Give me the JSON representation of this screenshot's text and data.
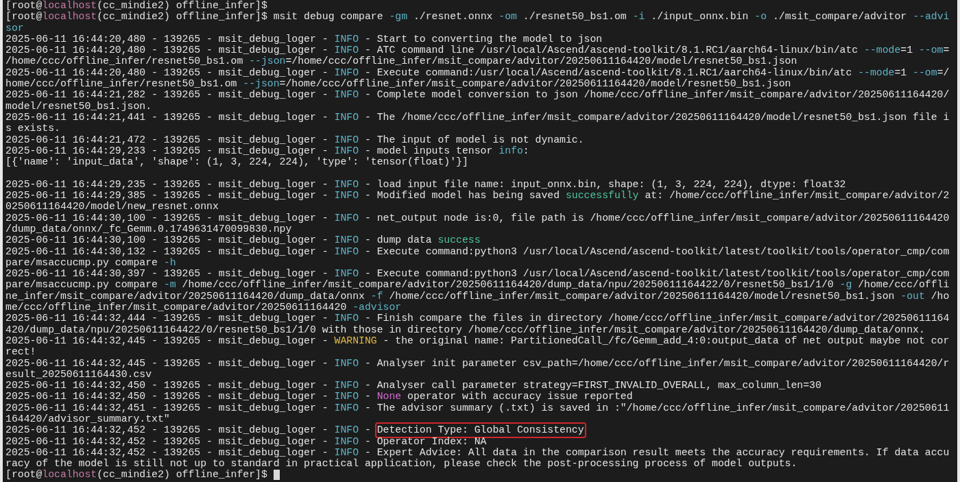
{
  "terminal": {
    "lines": [
      {
        "segments": [
          {
            "text": "[root@",
            "kind": "text"
          },
          {
            "text": "localhost",
            "kind": "host"
          },
          {
            "text": "(cc_mindie2) offline_infer]$",
            "kind": "text"
          }
        ]
      },
      {
        "segments": [
          {
            "text": "[root@",
            "kind": "text"
          },
          {
            "text": "localhost",
            "kind": "host"
          },
          {
            "text": "(cc_mindie2) offline_infer]$ msit debug compare ",
            "kind": "text"
          },
          {
            "text": "-gm",
            "kind": "flag"
          },
          {
            "text": " ./resnet.onnx ",
            "kind": "text"
          },
          {
            "text": "-om",
            "kind": "flag"
          },
          {
            "text": " ./resnet50_bs1.om ",
            "kind": "text"
          },
          {
            "text": "-i",
            "kind": "flag"
          },
          {
            "text": " ./input_onnx.bin ",
            "kind": "text"
          },
          {
            "text": "-o",
            "kind": "flag"
          },
          {
            "text": " ./msit_compare/advitor ",
            "kind": "text"
          },
          {
            "text": "--advi",
            "kind": "flag"
          }
        ]
      },
      {
        "segments": [
          {
            "text": "sor",
            "kind": "flag"
          }
        ]
      },
      {
        "segments": [
          {
            "text": "2025-06-11 16:44:20,480 - 139265 - msit_debug_loger - ",
            "kind": "text"
          },
          {
            "text": "INFO",
            "kind": "info"
          },
          {
            "text": " - Start to converting the model to json",
            "kind": "text"
          }
        ]
      },
      {
        "segments": [
          {
            "text": "2025-06-11 16:44:20,480 - 139265 - msit_debug_loger - ",
            "kind": "text"
          },
          {
            "text": "INFO",
            "kind": "info"
          },
          {
            "text": " - ATC command line /usr/local/Ascend/ascend-toolkit/8.1.RC1/aarch64-linux/bin/atc ",
            "kind": "text"
          },
          {
            "text": "--mode",
            "kind": "flag"
          },
          {
            "text": "=1 ",
            "kind": "text"
          },
          {
            "text": "--om",
            "kind": "flag"
          },
          {
            "text": "=",
            "kind": "text"
          }
        ]
      },
      {
        "segments": [
          {
            "text": "/home/ccc/offline_infer/resnet50_bs1.om ",
            "kind": "text"
          },
          {
            "text": "--json",
            "kind": "flag"
          },
          {
            "text": "=/home/ccc/offline_infer/msit_compare/advitor/20250611164420/model/resnet50_bs1.json",
            "kind": "text"
          }
        ]
      },
      {
        "segments": [
          {
            "text": "2025-06-11 16:44:20,480 - 139265 - msit_debug_loger - ",
            "kind": "text"
          },
          {
            "text": "INFO",
            "kind": "info"
          },
          {
            "text": " - Execute command:/usr/local/Ascend/ascend-toolkit/8.1.RC1/aarch64-linux/bin/atc ",
            "kind": "text"
          },
          {
            "text": "--mode",
            "kind": "flag"
          },
          {
            "text": "=1 ",
            "kind": "text"
          },
          {
            "text": "--om",
            "kind": "flag"
          },
          {
            "text": "=/",
            "kind": "text"
          }
        ]
      },
      {
        "segments": [
          {
            "text": "home/ccc/offline_infer/resnet50_bs1.om ",
            "kind": "text"
          },
          {
            "text": "--json",
            "kind": "flag"
          },
          {
            "text": "=/home/ccc/offline_infer/msit_compare/advitor/20250611164420/model/resnet50_bs1.json",
            "kind": "text"
          }
        ]
      },
      {
        "segments": [
          {
            "text": "2025-06-11 16:44:21,282 - 139265 - msit_debug_loger - ",
            "kind": "text"
          },
          {
            "text": "INFO",
            "kind": "info"
          },
          {
            "text": " - Complete model conversion to json /home/ccc/offline_infer/msit_compare/advitor/20250611164420/",
            "kind": "text"
          }
        ]
      },
      {
        "segments": [
          {
            "text": "model/resnet50_bs1.json.",
            "kind": "text"
          }
        ]
      },
      {
        "segments": [
          {
            "text": "2025-06-11 16:44:21,441 - 139265 - msit_debug_loger - ",
            "kind": "text"
          },
          {
            "text": "INFO",
            "kind": "info"
          },
          {
            "text": " - The /home/ccc/offline_infer/msit_compare/advitor/20250611164420/model/resnet50_bs1.json file i",
            "kind": "text"
          }
        ]
      },
      {
        "segments": [
          {
            "text": "s exists.",
            "kind": "text"
          }
        ]
      },
      {
        "segments": [
          {
            "text": "2025-06-11 16:44:21,472 - 139265 - msit_debug_loger - ",
            "kind": "text"
          },
          {
            "text": "INFO",
            "kind": "info"
          },
          {
            "text": " - The input of model is not dynamic.",
            "kind": "text"
          }
        ]
      },
      {
        "segments": [
          {
            "text": "2025-06-11 16:44:29,233 - 139265 - msit_debug_loger - ",
            "kind": "text"
          },
          {
            "text": "INFO",
            "kind": "info"
          },
          {
            "text": " - model inputs tensor ",
            "kind": "text"
          },
          {
            "text": "info",
            "kind": "flag"
          },
          {
            "text": ":",
            "kind": "text"
          }
        ]
      },
      {
        "segments": [
          {
            "text": "[{'name': 'input_data', 'shape': (1, 3, 224, 224), 'type': 'tensor(float)'}]",
            "kind": "text"
          }
        ]
      },
      {
        "kind": "blank"
      },
      {
        "segments": [
          {
            "text": "2025-06-11 16:44:29,235 - 139265 - msit_debug_loger - ",
            "kind": "text"
          },
          {
            "text": "INFO",
            "kind": "info"
          },
          {
            "text": " - load input file name: input_onnx.bin, shape: (1, 3, 224, 224), dtype: float32",
            "kind": "text"
          }
        ]
      },
      {
        "segments": [
          {
            "text": "2025-06-11 16:44:29,385 - 139265 - msit_debug_loger - ",
            "kind": "text"
          },
          {
            "text": "INFO",
            "kind": "info"
          },
          {
            "text": " - Modified model has being saved ",
            "kind": "text"
          },
          {
            "text": "successfully",
            "kind": "success"
          },
          {
            "text": " at: /home/ccc/offline_infer/msit_compare/advitor/2",
            "kind": "text"
          }
        ]
      },
      {
        "segments": [
          {
            "text": "0250611164420/model/new_resnet.onnx",
            "kind": "text"
          }
        ]
      },
      {
        "segments": [
          {
            "text": "2025-06-11 16:44:30,100 - 139265 - msit_debug_loger - ",
            "kind": "text"
          },
          {
            "text": "INFO",
            "kind": "info"
          },
          {
            "text": " - net_output node is:0, file path is /home/ccc/offline_infer/msit_compare/advitor/20250611164420",
            "kind": "text"
          }
        ]
      },
      {
        "segments": [
          {
            "text": "/dump_data/onnx/_fc_Gemm.0.1749631470099830.npy",
            "kind": "text"
          }
        ]
      },
      {
        "segments": [
          {
            "text": "2025-06-11 16:44:30,100 - 139265 - msit_debug_loger - ",
            "kind": "text"
          },
          {
            "text": "INFO",
            "kind": "info"
          },
          {
            "text": " - dump data ",
            "kind": "text"
          },
          {
            "text": "success",
            "kind": "success"
          }
        ]
      },
      {
        "segments": [
          {
            "text": "2025-06-11 16:44:30,132 - 139265 - msit_debug_loger - ",
            "kind": "text"
          },
          {
            "text": "INFO",
            "kind": "info"
          },
          {
            "text": " - Execute command:python3 /usr/local/Ascend/ascend-toolkit/latest/toolkit/tools/operator_cmp/com",
            "kind": "text"
          }
        ]
      },
      {
        "segments": [
          {
            "text": "pare/msaccucmp.py compare ",
            "kind": "text"
          },
          {
            "text": "-h",
            "kind": "flag"
          }
        ]
      },
      {
        "segments": [
          {
            "text": "2025-06-11 16:44:30,397 - 139265 - msit_debug_loger - ",
            "kind": "text"
          },
          {
            "text": "INFO",
            "kind": "info"
          },
          {
            "text": " - Execute command:python3 /usr/local/Ascend/ascend-toolkit/latest/toolkit/tools/operator_cmp/com",
            "kind": "text"
          }
        ]
      },
      {
        "segments": [
          {
            "text": "pare/msaccucmp.py compare ",
            "kind": "text"
          },
          {
            "text": "-m",
            "kind": "flag"
          },
          {
            "text": " /home/ccc/offline_infer/msit_compare/advitor/20250611164420/dump_data/npu/20250611164422/0/resnet50_bs1/1/0 ",
            "kind": "text"
          },
          {
            "text": "-g",
            "kind": "flag"
          },
          {
            "text": " /home/ccc/offli",
            "kind": "text"
          }
        ]
      },
      {
        "segments": [
          {
            "text": "ne_infer/msit_compare/advitor/20250611164420/dump_data/onnx ",
            "kind": "text"
          },
          {
            "text": "-f",
            "kind": "flag"
          },
          {
            "text": " /home/ccc/offline_infer/msit_compare/advitor/20250611164420/model/resnet50_bs1.json ",
            "kind": "text"
          },
          {
            "text": "-out",
            "kind": "flag"
          },
          {
            "text": " /ho",
            "kind": "text"
          }
        ]
      },
      {
        "segments": [
          {
            "text": "me/ccc/offline_infer/msit_compare/advitor/20250611164420 ",
            "kind": "text"
          },
          {
            "text": "-advisor",
            "kind": "flag"
          }
        ]
      },
      {
        "segments": [
          {
            "text": "2025-06-11 16:44:32,444 - 139265 - msit_debug_loger - ",
            "kind": "text"
          },
          {
            "text": "INFO",
            "kind": "info"
          },
          {
            "text": " - Finish compare the files in directory /home/ccc/offline_infer/msit_compare/advitor/20250611164",
            "kind": "text"
          }
        ]
      },
      {
        "segments": [
          {
            "text": "420/dump_data/npu/20250611164422/0/resnet50_bs1/1/0 with those in directory /home/ccc/offline_infer/msit_compare/advitor/20250611164420/dump_data/onnx.",
            "kind": "text"
          }
        ]
      },
      {
        "segments": [
          {
            "text": "2025-06-11 16:44:32,445 - 139265 - msit_debug_loger - ",
            "kind": "text"
          },
          {
            "text": "WARNING",
            "kind": "warning"
          },
          {
            "text": " - the original name: PartitionedCall_/fc/Gemm_add_4:0:output_data of net output maybe not cor",
            "kind": "text"
          }
        ]
      },
      {
        "segments": [
          {
            "text": "rect!",
            "kind": "text"
          }
        ]
      },
      {
        "segments": [
          {
            "text": "2025-06-11 16:44:32,445 - 139265 - msit_debug_loger - ",
            "kind": "text"
          },
          {
            "text": "INFO",
            "kind": "info"
          },
          {
            "text": " - Analyser init parameter csv_path=/home/ccc/offline_infer/msit_compare/advitor/20250611164420/r",
            "kind": "text"
          }
        ]
      },
      {
        "segments": [
          {
            "text": "esult_20250611164430.csv",
            "kind": "text"
          }
        ]
      },
      {
        "segments": [
          {
            "text": "2025-06-11 16:44:32,450 - 139265 - msit_debug_loger - ",
            "kind": "text"
          },
          {
            "text": "INFO",
            "kind": "info"
          },
          {
            "text": " - Analyser call parameter strategy=FIRST_INVALID_OVERALL, max_column_len=30",
            "kind": "text"
          }
        ]
      },
      {
        "segments": [
          {
            "text": "2025-06-11 16:44:32,450 - 139265 - msit_debug_loger - ",
            "kind": "text"
          },
          {
            "text": "INFO",
            "kind": "info"
          },
          {
            "text": " - ",
            "kind": "text"
          },
          {
            "text": "None",
            "kind": "keyword"
          },
          {
            "text": " operator with accuracy issue reported",
            "kind": "text"
          }
        ]
      },
      {
        "segments": [
          {
            "text": "2025-06-11 16:44:32,451 - 139265 - msit_debug_loger - ",
            "kind": "text"
          },
          {
            "text": "INFO",
            "kind": "info"
          },
          {
            "text": " - The advisor summary (.txt) is saved in :\"/home/ccc/offline_infer/msit_compare/advitor/20250611",
            "kind": "text"
          }
        ]
      },
      {
        "segments": [
          {
            "text": "164420/advisor_summary.txt\"",
            "kind": "text"
          }
        ]
      },
      {
        "segments": [
          {
            "text": "2025-06-11 16:44:32,452 - 139265 - msit_debug_loger - ",
            "kind": "text"
          },
          {
            "text": "INFO",
            "kind": "info"
          },
          {
            "text": " - ",
            "kind": "text"
          },
          {
            "text": "Detection Type: Global Consistency",
            "kind": "text",
            "boxed": true
          }
        ]
      },
      {
        "segments": [
          {
            "text": "2025-06-11 16:44:32,452 - 139265 - msit_debug_loger - ",
            "kind": "text"
          },
          {
            "text": "INFO",
            "kind": "info"
          },
          {
            "text": " - Operator Index: NA",
            "kind": "text"
          }
        ]
      },
      {
        "segments": [
          {
            "text": "2025-06-11 16:44:32,452 - 139265 - msit_debug_loger - ",
            "kind": "text"
          },
          {
            "text": "INFO",
            "kind": "info"
          },
          {
            "text": " - Expert Advice: All data in the comparison result meets the accuracy requirements. If data accu",
            "kind": "text"
          }
        ]
      },
      {
        "segments": [
          {
            "text": "racy of the model is still not up to standard in practical application, please check the post-processing process of model outputs.",
            "kind": "text"
          }
        ]
      },
      {
        "segments": [
          {
            "text": "[root@",
            "kind": "text"
          },
          {
            "text": "localhost",
            "kind": "host"
          },
          {
            "text": "(cc_mindie2) offline_infer]$ ",
            "kind": "text"
          }
        ],
        "cursor": true
      }
    ]
  }
}
